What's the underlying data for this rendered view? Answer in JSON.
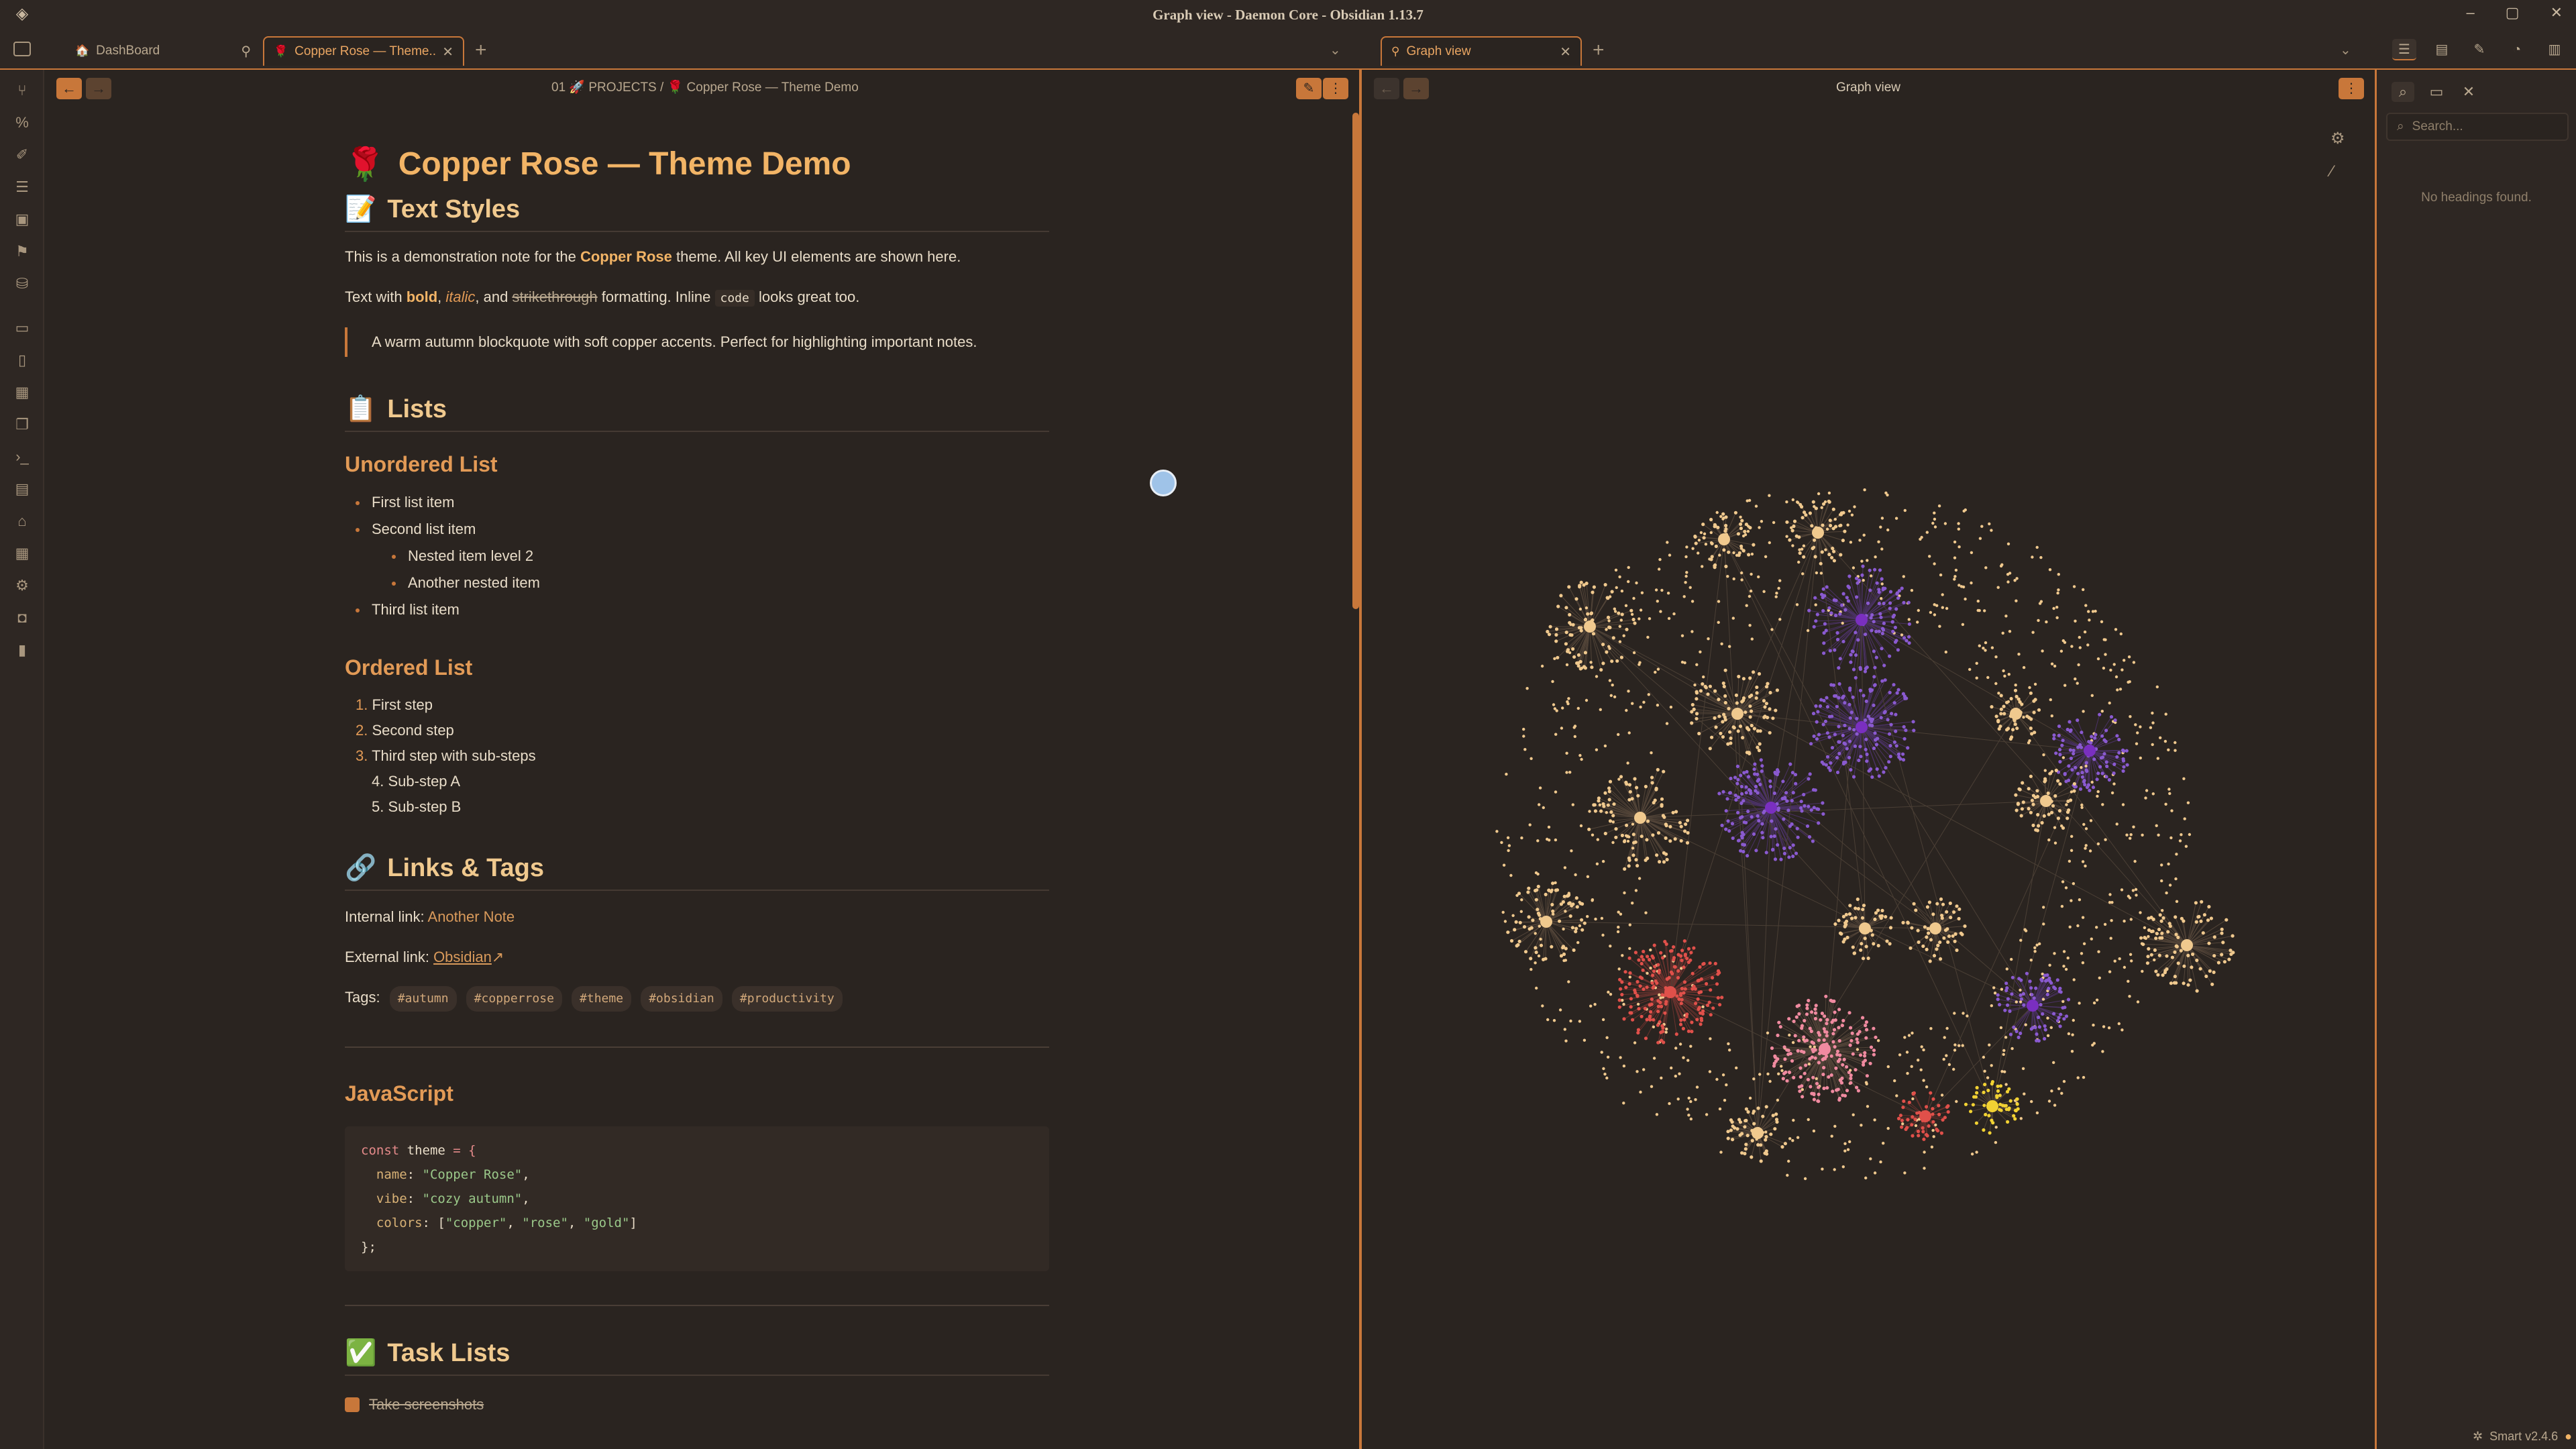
{
  "window": {
    "title": "Graph view - Daemon Core - Obsidian 1.13.7",
    "controls": [
      "–",
      "▢",
      "✕"
    ]
  },
  "tabs": {
    "left": [
      {
        "icon": "🏠",
        "label": "DashBoard",
        "pinned": true
      },
      {
        "icon": "🌹",
        "label": "Copper Rose — Theme...",
        "active": true
      }
    ],
    "right": [
      {
        "icon": "⚲",
        "label": "Graph view"
      }
    ]
  },
  "breadcrumb": {
    "folder_num": "01",
    "folder_icon": "🚀",
    "folder": "PROJECTS",
    "sep": "/",
    "note_icon": "🌹",
    "note": "Copper Rose — Theme Demo"
  },
  "note": {
    "title_icon": "🌹",
    "title": "Copper Rose — Theme Demo",
    "sections": {
      "text_styles": {
        "icon": "📝",
        "heading": "Text Styles"
      },
      "lists": {
        "icon": "📋",
        "heading": "Lists"
      },
      "links": {
        "icon": "🔗",
        "heading": "Links & Tags"
      },
      "tasks": {
        "icon": "✅",
        "heading": "Task Lists"
      }
    },
    "intro": {
      "before": "This is a demonstration note for the ",
      "bold": "Copper Rose",
      "after": " theme. All key UI elements are shown here."
    },
    "styles_line": {
      "t1": "Text with ",
      "bold": "bold",
      "t2": ", ",
      "italic": "italic",
      "t3": ", and ",
      "strike": "strikethrough",
      "t4": " formatting. Inline ",
      "code": "code",
      "t5": " looks great too."
    },
    "blockquote": "A warm autumn blockquote with soft copper accents. Perfect for highlighting important notes.",
    "unordered_heading": "Unordered List",
    "unordered": [
      "First list item",
      "Second list item",
      "Nested item level 2",
      "Another nested item",
      "Third list item"
    ],
    "ordered_heading": "Ordered List",
    "ordered": [
      {
        "n": "1.",
        "t": "First step"
      },
      {
        "n": "2.",
        "t": "Second step"
      },
      {
        "n": "3.",
        "t": "Third step with sub-steps"
      },
      {
        "n": "4.",
        "t": "Sub-step A"
      },
      {
        "n": "5.",
        "t": "Sub-step B"
      }
    ],
    "internal_label": "Internal link: ",
    "internal_link": "Another Note",
    "external_label": "External link: ",
    "external_link": "Obsidian",
    "tags_label": "Tags:",
    "tags": [
      "#autumn",
      "#copperrose",
      "#theme",
      "#obsidian",
      "#productivity"
    ],
    "js_heading": "JavaScript",
    "code_lines": {
      "l1a": "const",
      "l1b": " theme ",
      "l1c": "= {",
      "l2a": "  name",
      "l2b": ": ",
      "l2c": "\"Copper Rose\"",
      "l2d": ",",
      "l3a": "  vibe",
      "l3b": ": ",
      "l3c": "\"cozy autumn\"",
      "l3d": ",",
      "l4a": "  colors",
      "l4b": ": [",
      "l4c": "\"copper\"",
      "l4d": ", ",
      "l4e": "\"rose\"",
      "l4f": ", ",
      "l4g": "\"gold\"",
      "l4h": "]",
      "l5": "};"
    },
    "task_partial": "Take screenshots"
  },
  "graph": {
    "title": "Graph view"
  },
  "outline": {
    "search_placeholder": "Search...",
    "empty": "No headings found."
  },
  "status": {
    "smart": "Smart v2.4.6"
  },
  "colors": {
    "accent": "#c8773a",
    "heading": "#f2b466",
    "background": "#2a2420",
    "node_gold": "#f0c98e",
    "node_purple": "#8a5ad0",
    "node_red": "#e0504a",
    "node_pink": "#f08aa0",
    "node_yellow": "#f2d233"
  }
}
